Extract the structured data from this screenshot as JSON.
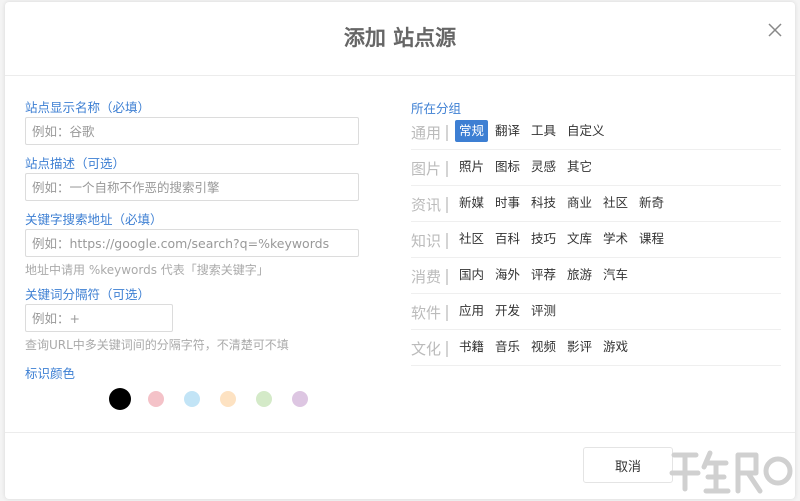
{
  "dialog": {
    "title": "添加 站点源",
    "cancel_label": "取消"
  },
  "form": {
    "name": {
      "label": "站点显示名称（必填）",
      "placeholder": "例如：谷歌"
    },
    "description": {
      "label": "站点描述（可选）",
      "placeholder": "例如：一个自称不作恶的搜索引擎"
    },
    "search_url": {
      "label": "关键字搜索地址（必填）",
      "placeholder": "例如：https://google.com/search?q=%keywords",
      "hint": "地址中请用 %keywords 代表「搜索关键字」"
    },
    "separator": {
      "label": "关键词分隔符（可选）",
      "placeholder": "例如：+",
      "hint": "查询URL中多关键词间的分隔字符，不清楚可不填"
    },
    "color": {
      "label": "标识颜色",
      "options": [
        "#000000",
        "#f4c2c8",
        "#c2e4f6",
        "#fde2c2",
        "#d4eac8",
        "#ddc6e2"
      ],
      "selected_index": 0
    }
  },
  "groups": {
    "label": "所在分组",
    "selected": "常规",
    "rows": [
      {
        "name": "通用",
        "items": [
          "常规",
          "翻译",
          "工具",
          "自定义"
        ]
      },
      {
        "name": "图片",
        "items": [
          "照片",
          "图标",
          "灵感",
          "其它"
        ]
      },
      {
        "name": "资讯",
        "items": [
          "新媒",
          "时事",
          "科技",
          "商业",
          "社区",
          "新奇"
        ]
      },
      {
        "name": "知识",
        "items": [
          "社区",
          "百科",
          "技巧",
          "文库",
          "学术",
          "课程"
        ]
      },
      {
        "name": "消费",
        "items": [
          "国内",
          "海外",
          "评荐",
          "旅游",
          "汽车"
        ]
      },
      {
        "name": "软件",
        "items": [
          "应用",
          "开发",
          "评测"
        ]
      },
      {
        "name": "文化",
        "items": [
          "书籍",
          "音乐",
          "视频",
          "影评",
          "游戏"
        ]
      }
    ]
  },
  "colors": {
    "accent": "#3d7fd3",
    "group_name": "#bbbbbb",
    "hint": "#aaaaaa"
  }
}
